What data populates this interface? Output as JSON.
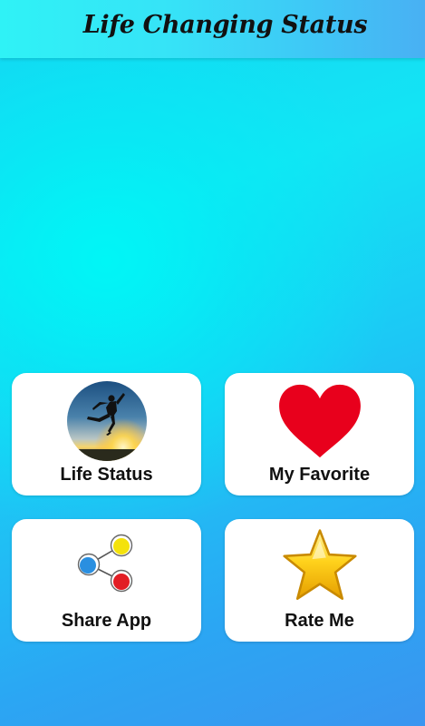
{
  "app_bar": {
    "title": "Life Changing Status"
  },
  "menu": {
    "items": [
      {
        "label": "Life Status",
        "icon": "jumping-person-sunset-icon"
      },
      {
        "label": "My Favorite",
        "icon": "heart-icon"
      },
      {
        "label": "Share App",
        "icon": "share-icon"
      },
      {
        "label": "Rate Me",
        "icon": "star-icon"
      }
    ]
  },
  "colors": {
    "background_top": "#13e4f4",
    "background_bottom": "#3a95f0",
    "card": "#ffffff",
    "heart": "#e8001c",
    "star": "#f2b705",
    "share_blue": "#2a8fe0",
    "share_yellow": "#f4e20c",
    "share_red": "#e21d24"
  }
}
